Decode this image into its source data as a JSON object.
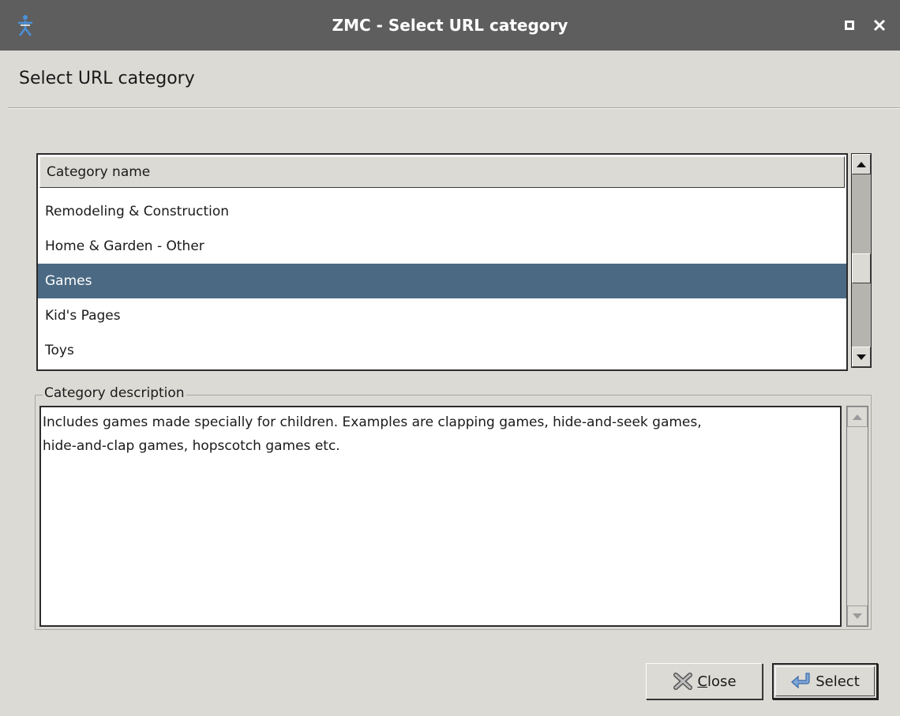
{
  "window": {
    "title": "ZMC - Select URL category"
  },
  "heading": "Select URL category",
  "category_list": {
    "column_header": "Category name",
    "rows": [
      "Remodeling & Construction",
      "Home & Garden - Other",
      "Games",
      "Kid's Pages",
      "Toys"
    ],
    "selected": "Games"
  },
  "description_group": {
    "label": "Category description",
    "line1": "Includes games made specially for children. Examples are clapping games, hide-and-seek games,",
    "line2": "hide-and-clap games, hopscotch games etc."
  },
  "buttons": {
    "close_mnemonic": "C",
    "close_rest": "lose",
    "select": "Select"
  },
  "colors": {
    "titlebar": "#5e5e5e",
    "selection": "#4b6983",
    "window_bg": "#dcdad5"
  }
}
